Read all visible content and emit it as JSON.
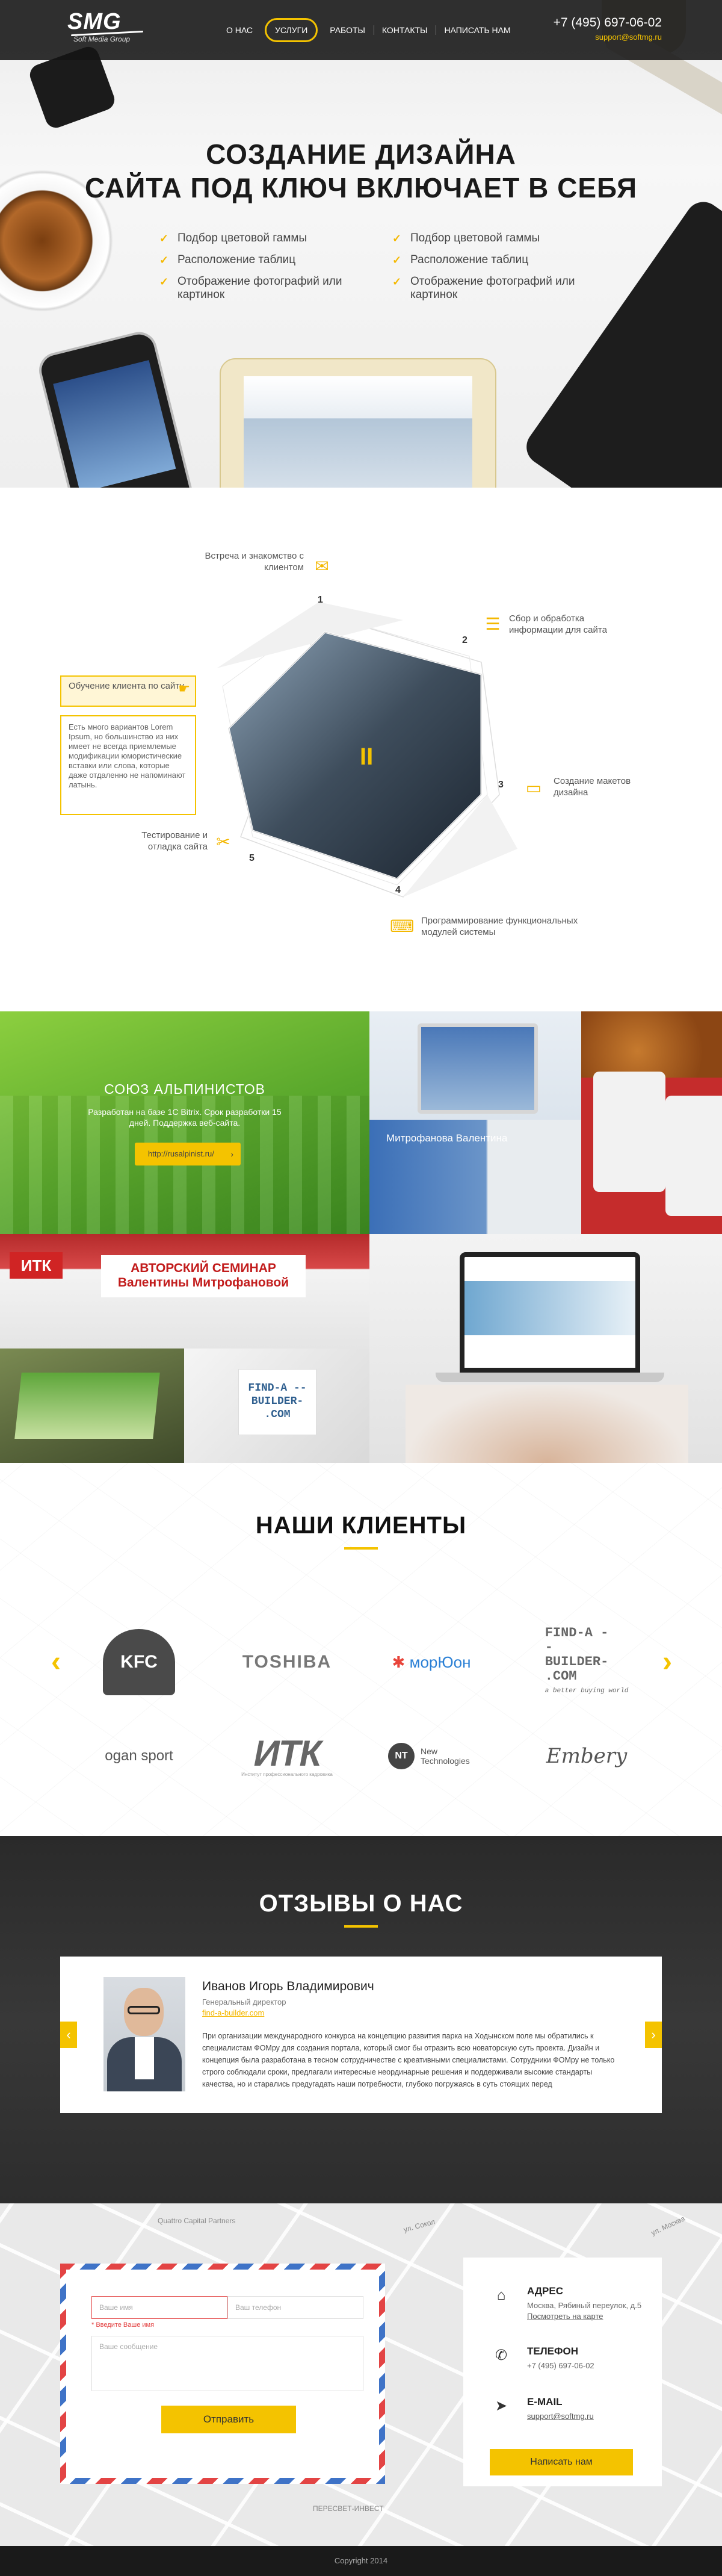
{
  "header": {
    "logo_main": "SMG",
    "logo_sub": "Soft Media Group",
    "nav": [
      "О НАС",
      "УСЛУГИ",
      "РАБОТЫ",
      "КОНТАКТЫ",
      "НАПИСАТЬ НАМ"
    ],
    "active_nav": "УСЛУГИ",
    "phone": "+7 (495) 697-06-02",
    "email": "support@softmg.ru",
    "accent_color": "#f4c300"
  },
  "hero": {
    "title_line1": "СОЗДАНИЕ ДИЗАЙНА",
    "title_line2": "САЙТА ПОД КЛЮЧ ВКЛЮЧАЕТ В СЕБЯ",
    "features_left": [
      "Подбор цветовой гаммы",
      "Расположение таблиц",
      "Отображение фотографий или картинок"
    ],
    "features_right": [
      "Подбор цветовой гаммы",
      "Расположение таблиц",
      "Отображение фотографий или картинок"
    ]
  },
  "process": {
    "steps": [
      {
        "num": "1",
        "label": "Встреча и знакомство с клиентом",
        "icon": "chat-icon"
      },
      {
        "num": "2",
        "label": "Сбор и обработка информации для сайта",
        "icon": "document-icon"
      },
      {
        "num": "3",
        "label": "Создание макетов дизайна",
        "icon": "monitor-icon"
      },
      {
        "num": "4",
        "label": "Программирование функциональных модулей системы",
        "icon": "code-icon"
      },
      {
        "num": "5",
        "label": "Тестирование и отладка сайта",
        "icon": "tools-icon"
      }
    ],
    "training_label": "Обучение клиента по сайту",
    "training_desc": "Есть много вариантов Lorem Ipsum, но большинство из них имеет не всегда приемлемые модификации юмористические вставки или слова, которые даже отдаленно не напоминают латынь.",
    "center_icon": "pause-icon"
  },
  "portfolio": {
    "green_title": "СОЮЗ АЛЬПИНИСТОВ",
    "green_desc": "Разработан на базе 1С Bitrix. Срок разработки 15 дней. Поддержка веб-сайта.",
    "green_link": "http://rusalpinist.ru/",
    "person_name": "Митрофанова Валентина",
    "seminar_logo": "ИТК",
    "seminar_head": "АВТОРСКИЙ СЕМИНАР Валентины Митрофановой",
    "find_card": "FIND-A --BUILDER- .COM"
  },
  "clients": {
    "title": "НАШИ КЛИЕНТЫ",
    "logos": [
      "KFC",
      "TOSHIBA",
      "морЮон",
      "FIND-A --BUILDER- .COM",
      "ogan sport",
      "ИТК",
      "New Technologies",
      "Embery"
    ],
    "find_sub": "a better buying world",
    "itk_sub": "Институт профессионального кадровика",
    "nt_mark": "NT"
  },
  "reviews": {
    "title": "ОТЗЫВЫ О НАС",
    "name": "Иванов Игорь Владимирович",
    "role": "Генеральный директор",
    "site": "find-a-builder.com",
    "text": "При организации международного конкурса на концепцию развития парка на Ходынском поле мы обратились к специалистам ФОМру для создания портала, который смог бы отразить всю новаторскую суть проекта. Дизайн и концепция была разработана в тесном сотрудничестве с креативными специалистами. Сотрудники ФОМру не только строго соблюдали сроки, предлагали интересные неординарные решения и поддерживали высокие стандарты качества, но и старались предугадать наши потребности, глубоко погружаясь в суть стоящих перед"
  },
  "contact": {
    "name_placeholder": "Ваше имя",
    "phone_placeholder": "Ваш телефон",
    "name_error": "* Введите Ваше имя",
    "message_placeholder": "Ваше сообщение",
    "send_label": "Отправить",
    "address_title": "АДРЕС",
    "address": "Москва, Рябиный переулок, д.5",
    "map_link": "Посмотреть на карте",
    "phone_title": "ТЕЛЕФОН",
    "phone": "+7 (495) 697-06-02",
    "email_title": "E-MAIL",
    "email": "support@softmg.ru",
    "write_label": "Написать нам",
    "streets": [
      "Quattro Capital Partners",
      "ул. Москва",
      "ПЕРЕСВЕТ-ИНВЕСТ",
      "ул. Сокол"
    ]
  },
  "footer": {
    "copyright": "Copyright 2014"
  }
}
